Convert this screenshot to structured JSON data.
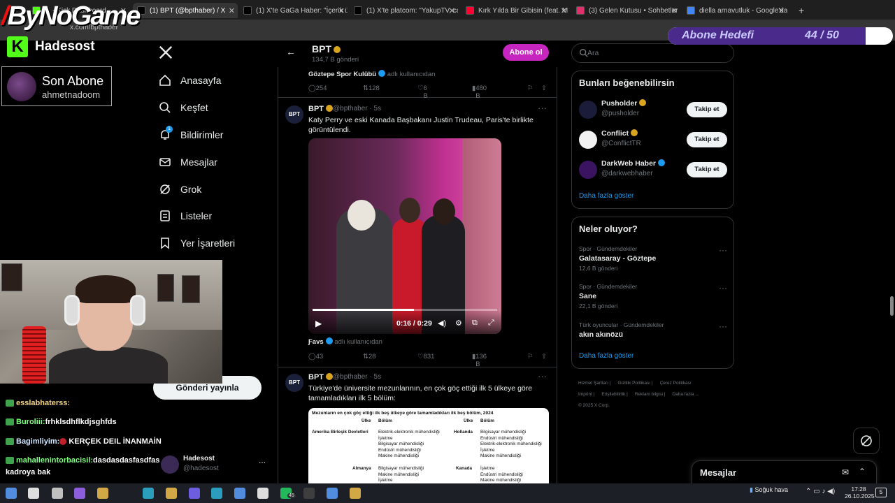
{
  "browser": {
    "tabs": [
      {
        "label": "... - Kick Dashboard",
        "color": "#53fc18",
        "active": false
      },
      {
        "label": "(1) BPT (@bpthaber) / X",
        "color": "#000000",
        "active": true
      },
      {
        "label": "(1) X'te GaGa Haber: \"İçerik üre",
        "color": "#000000",
        "active": false
      },
      {
        "label": "(1) X'te platcom: \"YakupTV, cam",
        "color": "#000000",
        "active": false
      },
      {
        "label": "Kırk Yılda Bir Gibisin (feat. M",
        "color": "#ff0033",
        "active": false
      },
      {
        "label": "(3) Gelen Kutusu • Sohbetler",
        "color": "#e1306c",
        "active": false
      },
      {
        "label": "diella arnavutluk - Google'da A",
        "color": "#4285f4",
        "active": false
      }
    ],
    "new_tab": "+",
    "address": "x.com/bpthaber"
  },
  "overlay": {
    "logo": "ByNoGame",
    "channel": "Hadesost",
    "kick_letter": "K",
    "last_sub_label": "Son Abone",
    "last_sub_user": "ahmetnadoom",
    "goal_label": "Abone Hedefi",
    "goal_count": "44 / 50",
    "goal_fraction": 0.88,
    "chat": [
      {
        "user": "esslabhaterss:",
        "msg": "",
        "ucolor": "u1"
      },
      {
        "user": "Buroliii:",
        "msg": "frhklsdhflkdjsghfds",
        "ucolor": "u2"
      },
      {
        "user": "Bagimliyim:",
        "msg": "KERÇEK DEIL İNANMAİN",
        "ucolor": "u4"
      },
      {
        "user": "mahallenintorbacisil:",
        "msg": "dasdasdasfasdfas",
        "ucolor": "u2"
      },
      {
        "user": "",
        "msg": "kadroya bak",
        "ucolor": "u4"
      }
    ]
  },
  "nav": {
    "items": [
      {
        "label": "Anasayfa",
        "icon": "home-icon"
      },
      {
        "label": "Keşfet",
        "icon": "search-icon"
      },
      {
        "label": "Bildirimler",
        "icon": "bell-icon",
        "badge": "1"
      },
      {
        "label": "Mesajlar",
        "icon": "mail-icon"
      },
      {
        "label": "Grok",
        "icon": "grok-icon"
      },
      {
        "label": "Listeler",
        "icon": "list-icon"
      },
      {
        "label": "Yer İşaretleri",
        "icon": "bookmark-icon"
      }
    ],
    "post_button": "Gönderi yayınla",
    "me_name": "Hadesost",
    "me_handle": "@hadesost",
    "me_more": "..."
  },
  "profile": {
    "back": "←",
    "name": "BPT",
    "posts": "134,7 B gönderi",
    "subscribe": "Abone ol"
  },
  "tweets": [
    {
      "reposter": "Göztepe Spor Kulübü",
      "reposter_note": "adlı kullanıcıdan",
      "replies": "254",
      "reposts": "128",
      "likes": "6 B",
      "views": "480 B"
    },
    {
      "name": "BPT",
      "handle": "@bpthaber · 5s",
      "text": "Katy Perry ve eski Kanada Başbakanı Justin Trudeau, Paris'te birlikte görüntülendi.",
      "video_time": "0:16 / 0:29",
      "video_progress": 0.55,
      "reposter": "Ƒavs",
      "reposter_note": "adlı kullanıcıdan",
      "replies": "43",
      "reposts": "28",
      "likes": "831",
      "views": "136 B"
    },
    {
      "name": "BPT",
      "handle": "@bpthaber · 5s",
      "text": "Türkiye'de üniversite mezunlarının, en çok göç ettiği ilk 5 ülkeye göre tamamladıkları ilk 5 bölüm:",
      "table": {
        "title": "Mezunların en çok göç ettiği ilk beş ülkeye göre tamamladıkları ilk beş bölüm, 2024",
        "h_country": "Ülke",
        "h_dept": "Bölüm",
        "left": [
          {
            "country": "Amerika Birleşik Devletleri",
            "depts": "Elektrik-elektronik mühendisliği\nİşletme\nBilgisayar mühendisliği\nEndüstri mühendisliği\nMakine mühendisliği"
          },
          {
            "country": "Almanya",
            "depts": "Bilgisayar mühendisliği\nMakine mühendisliği\nİşletme"
          }
        ],
        "right": [
          {
            "country": "Hollanda",
            "depts": "Bilgisayar mühendisliği\nEndüstri mühendisliği\nElektrik-elektronik mühendisliği\nİşletme\nMakine mühendisliği"
          },
          {
            "country": "Kanada",
            "depts": "İşletme\nEndüstri mühendisliği\nMakine mühendisliği"
          }
        ]
      }
    }
  ],
  "sidebar": {
    "search_placeholder": "Ara",
    "who_title": "Bunları beğenebilirsin",
    "who": [
      {
        "name": "Pusholder",
        "handle": "@pusholder",
        "badge": "gold",
        "avatar_color": "#1b1b3a"
      },
      {
        "name": "Conflict",
        "handle": "@ConflictTR",
        "badge": "gold",
        "avatar_color": "#f2f2f2"
      },
      {
        "name": "DarkWeb Haber",
        "handle": "@darkwebhaber",
        "badge": "blue",
        "avatar_color": "#3a1460"
      }
    ],
    "follow_label": "Takip et",
    "show_more": "Daha fazla göster",
    "trends_title": "Neler oluyor?",
    "trends": [
      {
        "context": "Spor · Gündemdekiler",
        "name": "Galatasaray - Göztepe",
        "posts": "12,6 B gönderi"
      },
      {
        "context": "Spor · Gündemdekiler",
        "name": "Sane",
        "posts": "22,1 B gönderi"
      },
      {
        "context": "Türk oyuncular · Gündemdekiler",
        "name": "akın akınözü",
        "posts": ""
      }
    ],
    "footer_line1": [
      "Hizmet Şartları",
      "Gizlilik Politikası",
      "Çerez Politikası"
    ],
    "footer_line2": [
      "Imprint",
      "Erişilebilirlik",
      "Reklam bilgisi",
      "Daha fazla ..."
    ],
    "footer_line3": "© 2025 X Corp.",
    "messages": "Mesajlar"
  },
  "taskbar": {
    "weather": "Soğuk hava",
    "time": "17:28",
    "date": "26.10.2025",
    "whatsapp_badge": "45",
    "notif_count": "5"
  }
}
